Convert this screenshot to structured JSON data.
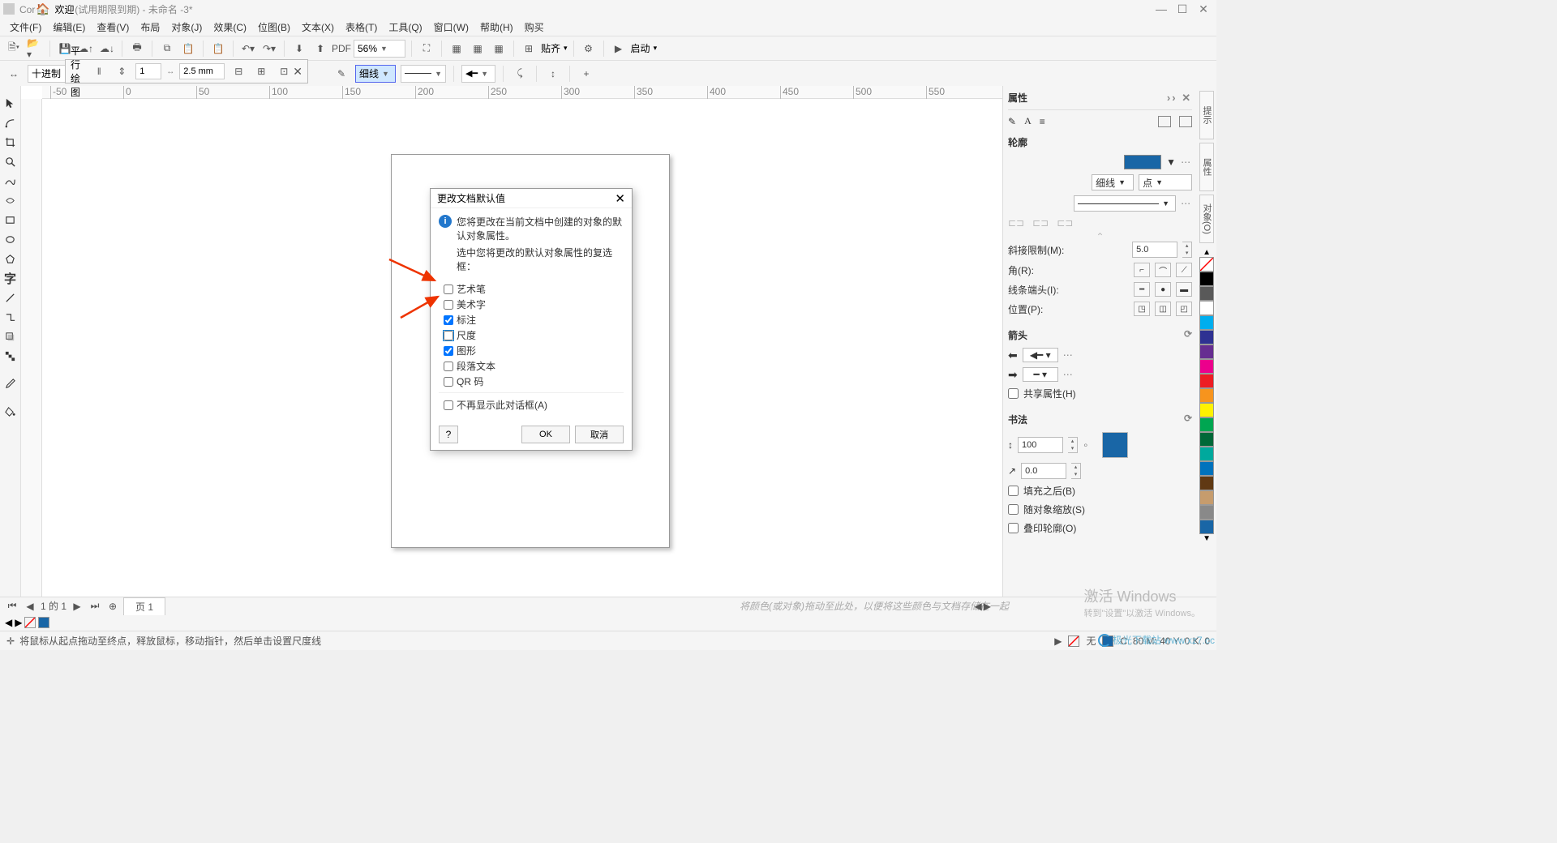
{
  "title": "CorelDRAW (试用期限到期) - 未命名 -3*",
  "menu": [
    "文件(F)",
    "编辑(E)",
    "查看(V)",
    "布局",
    "对象(J)",
    "效果(C)",
    "位图(B)",
    "文本(X)",
    "表格(T)",
    "工具(Q)",
    "窗口(W)",
    "帮助(H)",
    "购买"
  ],
  "toolbar1": {
    "zoom": "56%",
    "align_label": "贴齐",
    "launch_label": "启动"
  },
  "propbar2": {
    "mode": "十进制",
    "floating_title": "平行绘图",
    "floating_value1": "1",
    "floating_value2": "2.5 mm",
    "outline_width": "细线"
  },
  "tabstrip": {
    "welcome": "欢迎"
  },
  "dialog": {
    "title": "更改文档默认值",
    "msg1": "您将更改在当前文档中创建的对象的默认对象属性。",
    "msg2": "选中您将更改的默认对象属性的复选框：",
    "checks": [
      {
        "label": "艺术笔",
        "checked": false
      },
      {
        "label": "美术字",
        "checked": false
      },
      {
        "label": "标注",
        "checked": true
      },
      {
        "label": "尺度",
        "checked": false,
        "highlight": true
      },
      {
        "label": "图形",
        "checked": true
      },
      {
        "label": "段落文本",
        "checked": false
      },
      {
        "label": "QR 码",
        "checked": false
      }
    ],
    "dont_show": "不再显示此对话框(A)",
    "ok": "OK",
    "cancel": "取消"
  },
  "right": {
    "panel_title": "属性",
    "outline": "轮廓",
    "width_sel": "细线",
    "unit_sel": "点",
    "miter_label": "斜接限制(M):",
    "miter_val": "5.0",
    "corner_label": "角(R):",
    "linecap_label": "线条端头(I):",
    "position_label": "位置(P):",
    "arrow_section": "箭头",
    "share_label": "共享属性(H)",
    "calli_section": "书法",
    "calli_v1": "100",
    "calli_v2": "0.0",
    "chk1": "填充之后(B)",
    "chk2": "随对象缩放(S)",
    "chk3": "叠印轮廓(O)"
  },
  "palette": [
    "#000000",
    "#595959",
    "#ffffff",
    "#00aeef",
    "#ed1c24",
    "#2e3192",
    "#662d91",
    "#ec008c",
    "#fff200",
    "#00a651",
    "#f7941d",
    "#898989",
    "#603913",
    "#a30234",
    "#1a6600",
    "#0d4f8b"
  ],
  "vtabs": [
    "提示",
    "属性",
    "对象(O)"
  ],
  "bottom": {
    "page_indicator": "1 的 1",
    "page_tab": "页 1",
    "hint": "将颜色(或对象)拖动至此处，以便将这些颜色与文档存储在一起"
  },
  "status": {
    "text": "将鼠标从起点拖动至终点，释放鼠标，移动指针，然后单击设置尺度线",
    "none_label": "无",
    "coords": "C:  80 M:  40 Y:   0 K:   0"
  },
  "activate": {
    "l1": "激活 Windows",
    "l2": "转到\"设置\"以激活 Windows。"
  },
  "watermark": "极光下载站  www.xz7.cc"
}
